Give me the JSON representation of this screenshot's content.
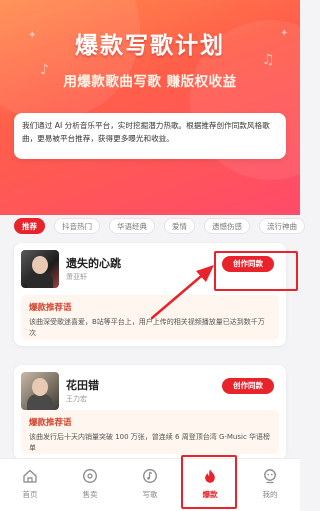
{
  "hero": {
    "title": "爆款写歌计划",
    "subtitle": "用爆款歌曲写歌 赚版权收益"
  },
  "intro": {
    "text": "我们通过 AI 分析音乐平台，实时挖掘潜力热歌。根据推荐创作同款风格歌曲，更易被平台推荐，获得更多曝光和收益。"
  },
  "tabs": [
    {
      "label": "推荐",
      "active": true
    },
    {
      "label": "抖音热门",
      "active": false
    },
    {
      "label": "华语经典",
      "active": false
    },
    {
      "label": "爱情",
      "active": false
    },
    {
      "label": "遗憾伤感",
      "active": false
    },
    {
      "label": "流行神曲",
      "active": false
    }
  ],
  "songs": [
    {
      "title": "遗失的心跳",
      "artist": "萧亚轩",
      "button": "创作同款",
      "rec_title": "爆款推荐语",
      "rec_text": "该曲深受歌迷喜爱，B站等平台上，用户上传的相关视频播放量已达到数千万次"
    },
    {
      "title": "花田错",
      "artist": "王力宏",
      "button": "创作同款",
      "rec_title": "爆款推荐语",
      "rec_text": "该曲发行后十天内销量突破 100 万张，曾连续 6 周登顶台湾 G-Music 华语榜单"
    }
  ],
  "tabbar": [
    {
      "label": "首页",
      "icon": "home-icon",
      "active": false
    },
    {
      "label": "售卖",
      "icon": "vinyl-icon",
      "active": false
    },
    {
      "label": "写歌",
      "icon": "music-note-icon",
      "active": false
    },
    {
      "label": "爆款",
      "icon": "flame-icon",
      "active": true
    },
    {
      "label": "我的",
      "icon": "user-icon",
      "active": false
    }
  ],
  "colors": {
    "accent": "#e8232b",
    "hero_start": "#ff8a4c",
    "hero_end": "#ff4b6a",
    "rec_bg": "#fff6ef"
  }
}
